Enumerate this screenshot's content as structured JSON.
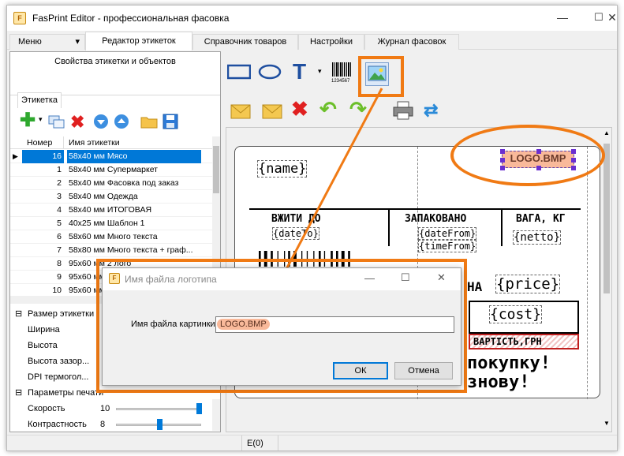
{
  "window": {
    "title": "FasPrint Editor - профессиональная фасовка",
    "minimize": "—",
    "maximize": "☐",
    "close": "✕"
  },
  "tabs": [
    "Меню",
    "Редактор этикеток",
    "Справочник товаров",
    "Настройки",
    "Журнал фасовок"
  ],
  "menu_arrow": "▾",
  "left": {
    "header": "Свойства этикетки и объектов",
    "subtab": "Этикетка",
    "grid": {
      "col_num": "Номер",
      "col_name": "Имя этикетки",
      "rows": [
        {
          "num": "16",
          "name": "58x40 мм Мясо"
        },
        {
          "num": "1",
          "name": "58x40 мм Супермаркет"
        },
        {
          "num": "2",
          "name": "58x40 мм Фасовка под заказ"
        },
        {
          "num": "3",
          "name": "58x40 мм Одежда"
        },
        {
          "num": "4",
          "name": "58x40 мм ИТОГОВАЯ"
        },
        {
          "num": "5",
          "name": "40x25 мм Шаблон 1"
        },
        {
          "num": "6",
          "name": "58x60 мм Много текста"
        },
        {
          "num": "7",
          "name": "58x80 мм Много текста + граф..."
        },
        {
          "num": "8",
          "name": "95x60 мм 2 лого"
        },
        {
          "num": "9",
          "name": "95x60 мм"
        },
        {
          "num": "10",
          "name": "95x60 мм"
        }
      ]
    },
    "props": {
      "group1": "Размер этикетки",
      "width": "Ширина",
      "height": "Высота",
      "gap": "Высота зазор...",
      "dpi": "DPI термогол...",
      "group2": "Параметры печати",
      "speed": "Скорость",
      "speed_val": "10",
      "contrast": "Контрастность",
      "contrast_val": "8"
    }
  },
  "label": {
    "name": "{name}",
    "logo": "LOGO.BMP",
    "h1": "ВЖИТИ ДО",
    "h2": "ЗАПАКОВАНО",
    "h3": "ВАГА, КГ",
    "dateTo": "{dateTo}",
    "dateFrom": "{dateFrom}",
    "timeFrom": "{timeFrom}",
    "netto": "{netto}",
    "price_prefix": "НА",
    "price": "{price}",
    "cost": "{cost}",
    "cost_label": "ВАРТІСТЬ,ГРН",
    "promo1": "покупку!",
    "promo2": "знову!"
  },
  "dialog": {
    "title": "Имя файла логотипа",
    "field_label": "Имя файла картинки",
    "field_value": "LOGO.BMP",
    "ok": "ОК",
    "cancel": "Отмена"
  },
  "status": {
    "text": "E(0)"
  },
  "colors": {
    "accent": "#f07a14",
    "selection": "#0078d7"
  }
}
